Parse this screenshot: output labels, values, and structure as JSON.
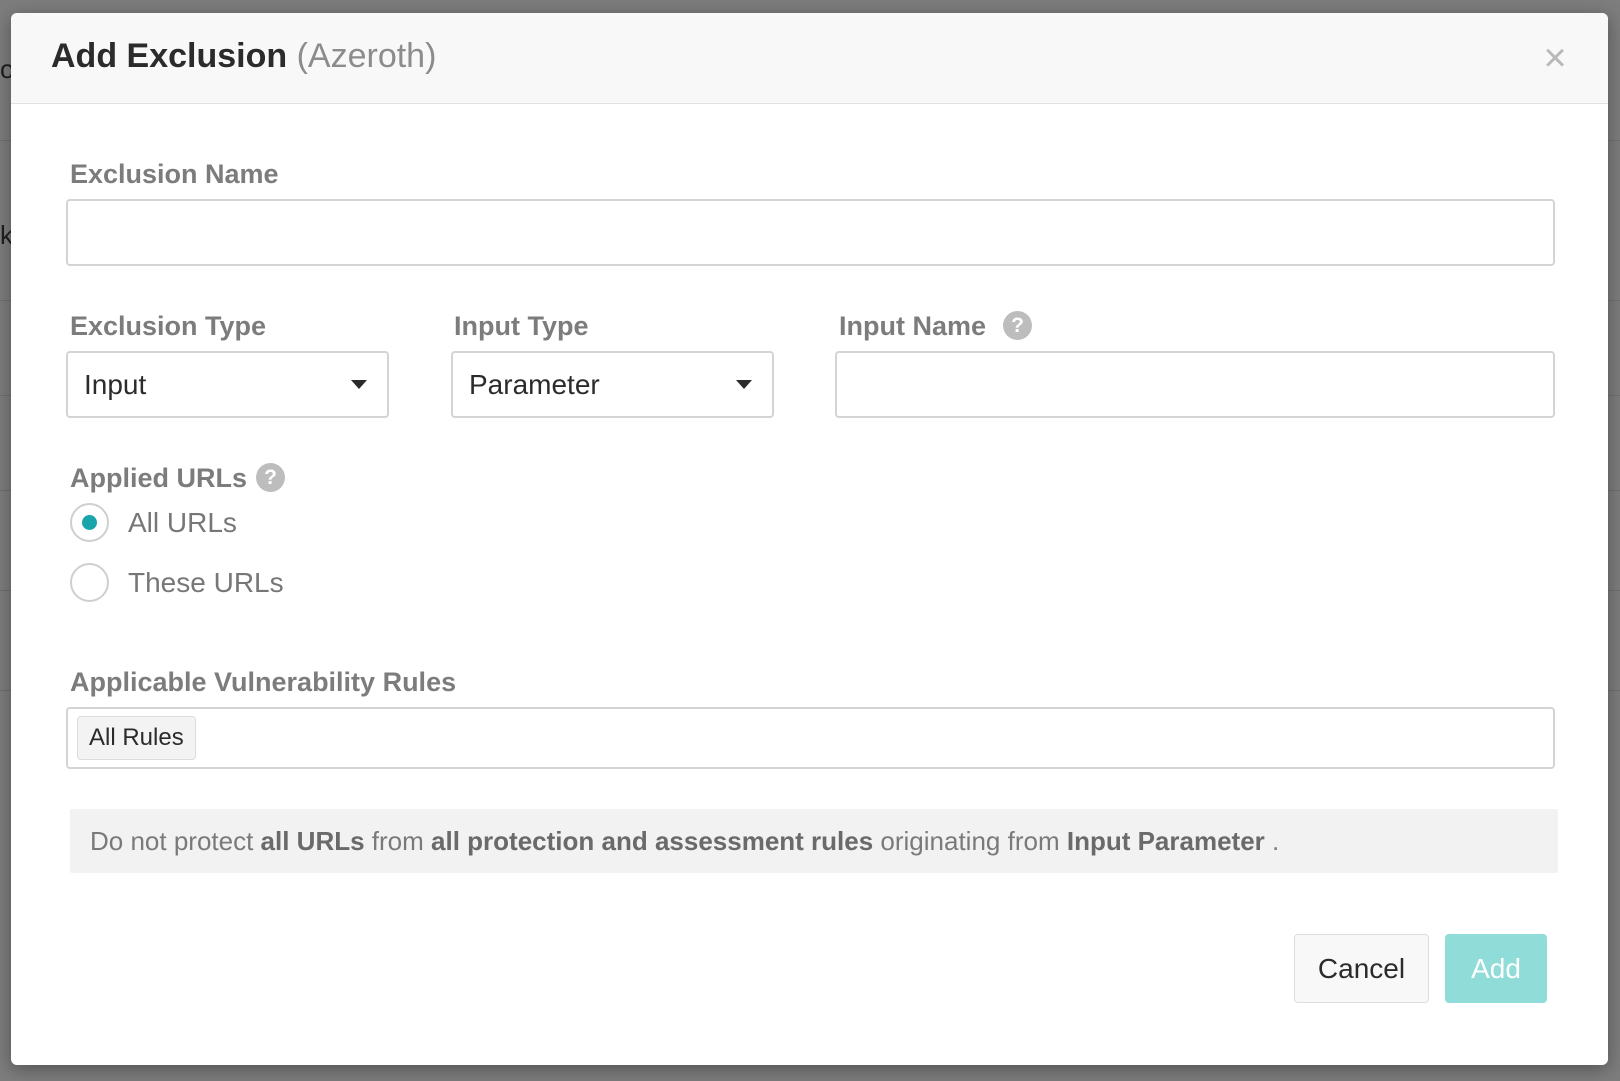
{
  "background": {
    "glyph_left_top": "o",
    "glyph_left_mid": "k"
  },
  "dialog": {
    "title": "Add Exclusion",
    "subtitle": "(Azeroth)",
    "close_glyph": "×"
  },
  "form": {
    "exclusion_name": {
      "label": "Exclusion Name",
      "value": "",
      "placeholder": ""
    },
    "exclusion_type": {
      "label": "Exclusion Type",
      "selected": "Input"
    },
    "input_type": {
      "label": "Input Type",
      "selected": "Parameter"
    },
    "input_name": {
      "label": "Input Name",
      "value": "",
      "placeholder": "",
      "help_glyph": "?"
    },
    "applied_urls": {
      "label": "Applied URLs",
      "help_glyph": "?",
      "options": [
        {
          "label": "All URLs",
          "checked": true
        },
        {
          "label": "These URLs",
          "checked": false
        }
      ]
    },
    "vulnerability_rules": {
      "label": "Applicable Vulnerability Rules",
      "tags": [
        "All Rules"
      ]
    }
  },
  "summary": {
    "part1": "Do not protect ",
    "bold1": "all URLs",
    "part2": " from ",
    "bold2": "all protection and assessment rules",
    "part3": " originating from ",
    "bold3": "Input Parameter",
    "part4": " ."
  },
  "buttons": {
    "cancel": "Cancel",
    "add": "Add"
  },
  "colors": {
    "accent": "#1aa5ad",
    "add_button": "#8fdcd8"
  }
}
